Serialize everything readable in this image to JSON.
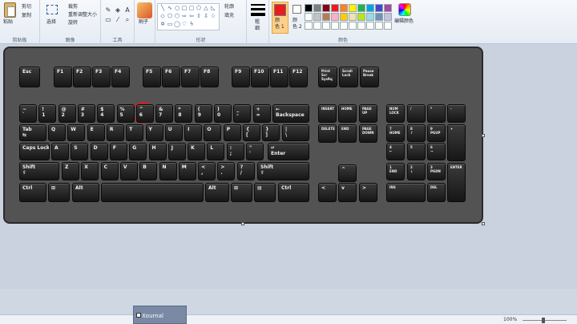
{
  "ribbon": {
    "clipboard": {
      "paste": "粘贴",
      "cut": "剪切",
      "copy": "复制",
      "group": "剪贴板"
    },
    "image": {
      "select": "选择",
      "crop": "裁剪",
      "resize": "重新调整大小",
      "rotate": "旋转",
      "group": "图像"
    },
    "tools": {
      "group": "工具",
      "icons": [
        "pencil-icon",
        "fill-icon",
        "text-icon",
        "eraser-icon",
        "picker-icon",
        "magnifier-icon"
      ]
    },
    "brush": {
      "label": "刷子"
    },
    "shapes": {
      "outline": "轮廓",
      "fill": "填充",
      "group": "形状"
    },
    "size": {
      "label": "粗\n细"
    },
    "colors": {
      "color1": "颜\n色 1",
      "color2": "颜\n色 2",
      "edit": "编辑颜色",
      "group": "颜色",
      "palette": [
        "#000000",
        "#7f7f7f",
        "#880015",
        "#ed1c24",
        "#ff7f27",
        "#fff200",
        "#22b14c",
        "#00a2e8",
        "#3f48cc",
        "#a349a4",
        "#ffffff",
        "#c3c3c3",
        "#b97a57",
        "#ffaec9",
        "#ffc90e",
        "#efe4b0",
        "#b5e61d",
        "#99d9ea",
        "#7092be",
        "#c8bfe7",
        "#ffffff",
        "#ffffff",
        "#ffffff",
        "#ffffff",
        "#ffffff",
        "#ffffff",
        "#ffffff",
        "#ffffff",
        "#ffffff",
        "#ffffff"
      ]
    }
  },
  "keyboard": {
    "frow": [
      "Esc",
      "F1",
      "F2",
      "F3",
      "F4",
      "F5",
      "F6",
      "F7",
      "F8",
      "F9",
      "F10",
      "F11",
      "F12"
    ],
    "sys": [
      "Print\nScr\nSysRq",
      "Scroll\nLock",
      "Pause\nBreak"
    ],
    "num": [
      "~\n`",
      "!\n1",
      "@\n2",
      "#\n3",
      "$\n4",
      "%\n5",
      "^\n6",
      "&\n7",
      "*\n8",
      "(\n9",
      ")\n0",
      "_\n-",
      "+\n=",
      "←\nBackspace"
    ],
    "qrow": [
      "Tab\n⇆",
      "Q",
      "W",
      "E",
      "R",
      "T",
      "Y",
      "U",
      "I",
      "O",
      "P",
      "{\n[",
      "}\n]",
      "|\n\\"
    ],
    "arow": [
      "Caps Lock",
      "A",
      "S",
      "D",
      "F",
      "G",
      "H",
      "J",
      "K",
      "L",
      ":\n;",
      "\"\n'",
      "↵\nEnter"
    ],
    "zrow": [
      "Shift\n⇧",
      "Z",
      "X",
      "C",
      "V",
      "B",
      "N",
      "M",
      "<\n,",
      ">\n.",
      "?\n/",
      "Shift\n⇧"
    ],
    "brow": [
      "Ctrl",
      "⊞",
      "Alt",
      "",
      "Alt",
      "⊞",
      "▤",
      "Ctrl"
    ],
    "nav": [
      "INSERT",
      "HOME",
      "PAGE\nUP",
      "DELETE",
      "END",
      "PAGE\nDOWN"
    ],
    "arrows": [
      "^",
      "<",
      "v",
      ">"
    ],
    "numpad": [
      "NUM\nLOCK",
      "/",
      "*",
      "-",
      "7\nHOME",
      "8\n↑",
      "9\nPGUP",
      "+",
      "4\n←",
      "5",
      "6\n→",
      "1\nEND",
      "2\n↓",
      "3\nPGDN",
      "ENTER",
      "INS",
      "DEL"
    ]
  },
  "status": {
    "zoom": "100%"
  },
  "taskbar": {
    "xournal": "Xournal"
  }
}
